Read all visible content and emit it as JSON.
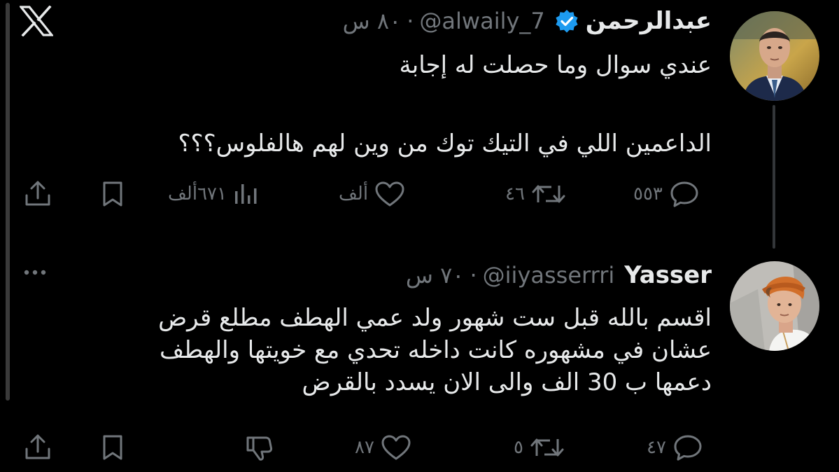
{
  "app": {
    "logo_icon": "x-logo-icon"
  },
  "colors": {
    "background": "#000000",
    "text": "#e7e9ea",
    "muted": "#71767b",
    "verified": "#1d9bf0",
    "thread_line": "#333639"
  },
  "tweets": [
    {
      "display_name": "عبدالرحمن",
      "verified": true,
      "handle": "@alwaily_7",
      "separator": "·",
      "time": "٨٠ س",
      "text_lines": [
        "عندي سوال وما حصلت له إجابة",
        "الداعمين اللي في التيك توك من وين لهم هالفلوس؟؟؟"
      ],
      "actions": {
        "reply_count": "٥٥٣",
        "retweet_count": "٤٦",
        "like_count": "ألف",
        "views_count": "٦٧١ألف"
      }
    },
    {
      "display_name": "Yasser",
      "verified": false,
      "handle": "@iiyasserrri",
      "separator": "·",
      "time": "٧٠ س",
      "text_lines": [
        "اقسم بالله قبل ست شهور ولد عمي الهطف مطلع قرض",
        "عشان في مشهوره كانت داخله تحدي مع خويتها والهطف",
        "دعمها ب 30 الف والى الان يسدد بالقرض"
      ],
      "actions": {
        "reply_count": "٤٧",
        "retweet_count": "٥",
        "like_count": "٨٧"
      }
    }
  ]
}
